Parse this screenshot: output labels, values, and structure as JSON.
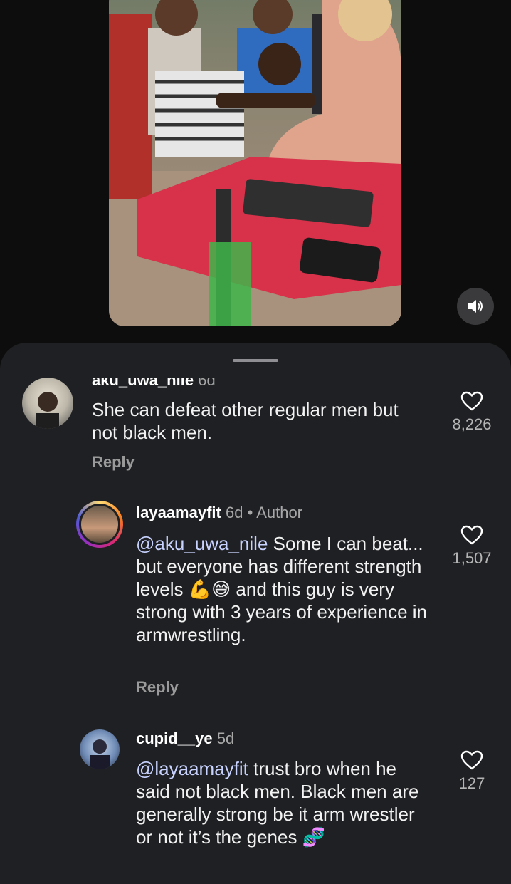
{
  "video": {
    "mute_icon": "speaker-icon"
  },
  "comments": [
    {
      "username": "aku_uwa_nile",
      "age": "6d",
      "text": "She can defeat other regular men but not black men.",
      "reply_label": "Reply",
      "likes": "8,226"
    },
    {
      "username": "layaamayfit",
      "age": "6d",
      "author_badge": "• Author",
      "mention": "@aku_uwa_nile",
      "text_part1": " Some I can beat... but everyone has different strength levels ",
      "emoji": "💪😅",
      "text_part2": " and this guy is very strong with 3 years of experience in armwrestling.",
      "reply_label": "Reply",
      "likes": "1,507"
    },
    {
      "username": "cupid__ye",
      "age": "5d",
      "mention": "@layaamayfit",
      "text": " trust bro when he said not black men. Black men are generally strong be it arm wrestler or not it’s the genes",
      "emoji": "🧬",
      "likes": "127"
    }
  ]
}
